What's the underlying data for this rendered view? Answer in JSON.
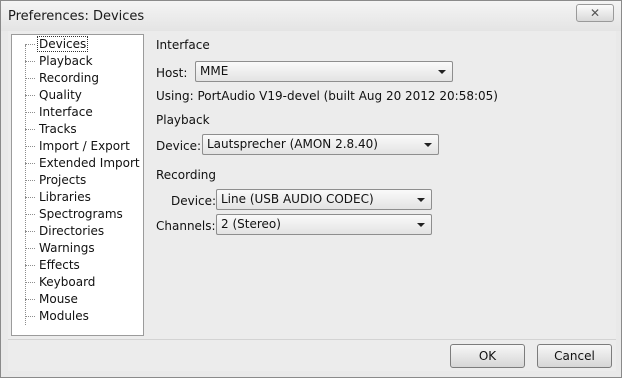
{
  "window": {
    "title": "Preferences: Devices",
    "close_glyph": "✕"
  },
  "tree": {
    "items": [
      {
        "label": "Devices"
      },
      {
        "label": "Playback"
      },
      {
        "label": "Recording"
      },
      {
        "label": "Quality"
      },
      {
        "label": "Interface"
      },
      {
        "label": "Tracks"
      },
      {
        "label": "Import / Export"
      },
      {
        "label": "Extended Import"
      },
      {
        "label": "Projects"
      },
      {
        "label": "Libraries"
      },
      {
        "label": "Spectrograms"
      },
      {
        "label": "Directories"
      },
      {
        "label": "Warnings"
      },
      {
        "label": "Effects"
      },
      {
        "label": "Keyboard"
      },
      {
        "label": "Mouse"
      },
      {
        "label": "Modules"
      }
    ],
    "selected": "Devices"
  },
  "interface": {
    "section_label": "Interface",
    "host_label": "Host:",
    "host_value": "MME",
    "using_text": "Using: PortAudio V19-devel (built Aug 20 2012 20:58:05)"
  },
  "playback": {
    "section_label": "Playback",
    "device_label": "Device:",
    "device_value": "Lautsprecher (AMON 2.8.40)"
  },
  "recording": {
    "section_label": "Recording",
    "device_label": "Device:",
    "device_value": "Line (USB AUDIO  CODEC)",
    "channels_label": "Channels:",
    "channels_value": "2 (Stereo)"
  },
  "buttons": {
    "ok": "OK",
    "cancel": "Cancel"
  }
}
